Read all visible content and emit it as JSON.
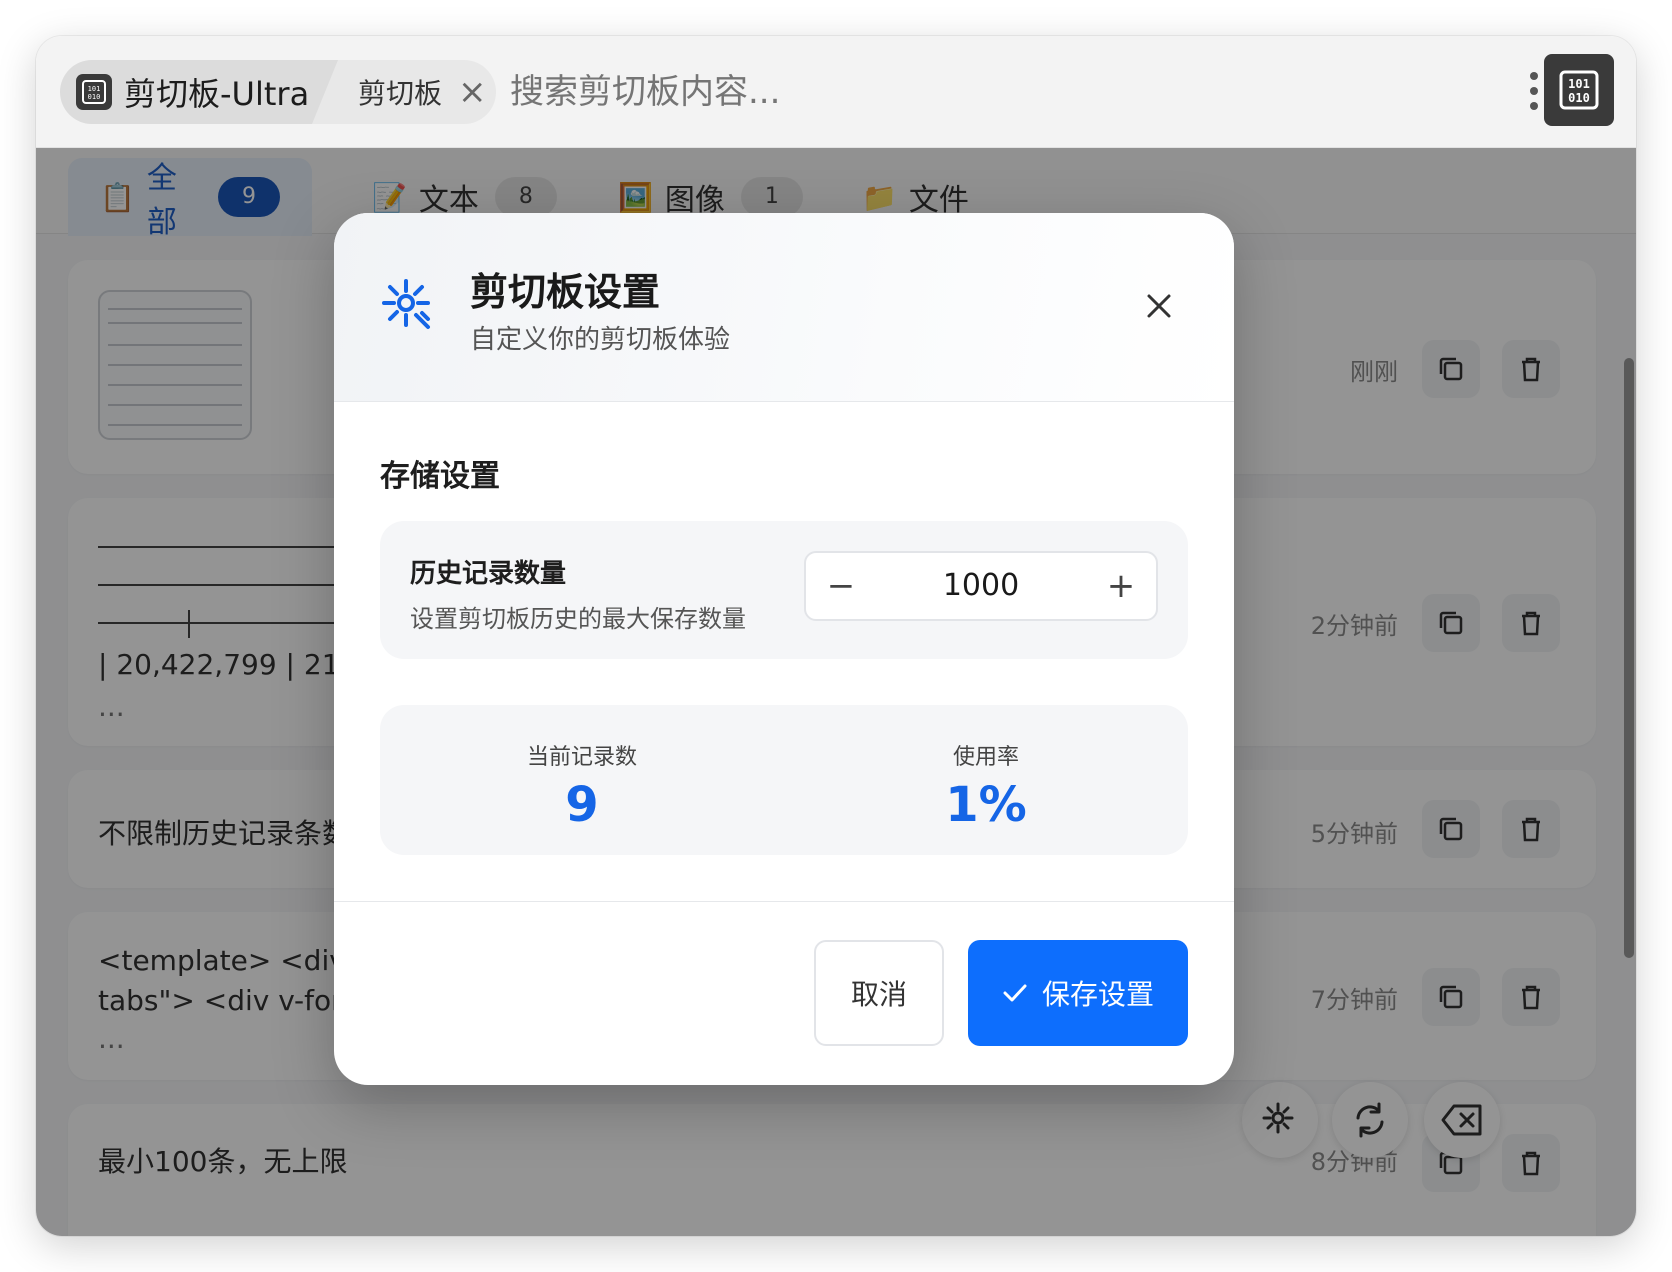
{
  "window": {
    "app_tab_title": "剪切板-Ultra",
    "second_tab_label": "剪切板",
    "second_tab_close": "×",
    "search_placeholder": "搜索剪切板内容..."
  },
  "filters": [
    {
      "icon": "📋",
      "label": "全部",
      "count": "9",
      "active": true
    },
    {
      "icon": "📝",
      "label": "文本",
      "count": "8",
      "active": false
    },
    {
      "icon": "🖼️",
      "label": "图像",
      "count": "1",
      "active": false
    },
    {
      "icon": "📁",
      "label": "文件",
      "count": "",
      "active": false
    }
  ],
  "items": [
    {
      "type": "image",
      "text": "",
      "time": "刚刚"
    },
    {
      "type": "text",
      "text_line1": "| 20,422,799 | 21,45",
      "text_line2": "...",
      "time": "2分钟前"
    },
    {
      "type": "text",
      "text_line1": "不限制历史记录条数",
      "time": "5分钟前"
    },
    {
      "type": "text",
      "text_line1": "<template> <div cla",
      "text_line2": "tabs\"> <div v-for=\"t",
      "text_line3": "...",
      "time": "7分钟前"
    },
    {
      "type": "text",
      "text_line1": "最小100条，无上限",
      "time": "8分钟前"
    }
  ],
  "modal": {
    "title": "剪切板设置",
    "subtitle": "自定义你的剪切板体验",
    "section_title": "存储设置",
    "history_label": "历史记录数量",
    "history_desc": "设置剪切板历史的最大保存数量",
    "history_value": "1000",
    "stepper_minus": "−",
    "stepper_plus": "+",
    "stat_current_label": "当前记录数",
    "stat_current_value": "9",
    "stat_usage_label": "使用率",
    "stat_usage_value": "1%",
    "cancel_label": "取消",
    "save_label": "保存设置"
  },
  "colors": {
    "accent": "#0d6efd",
    "stat_value": "#1565e6"
  }
}
